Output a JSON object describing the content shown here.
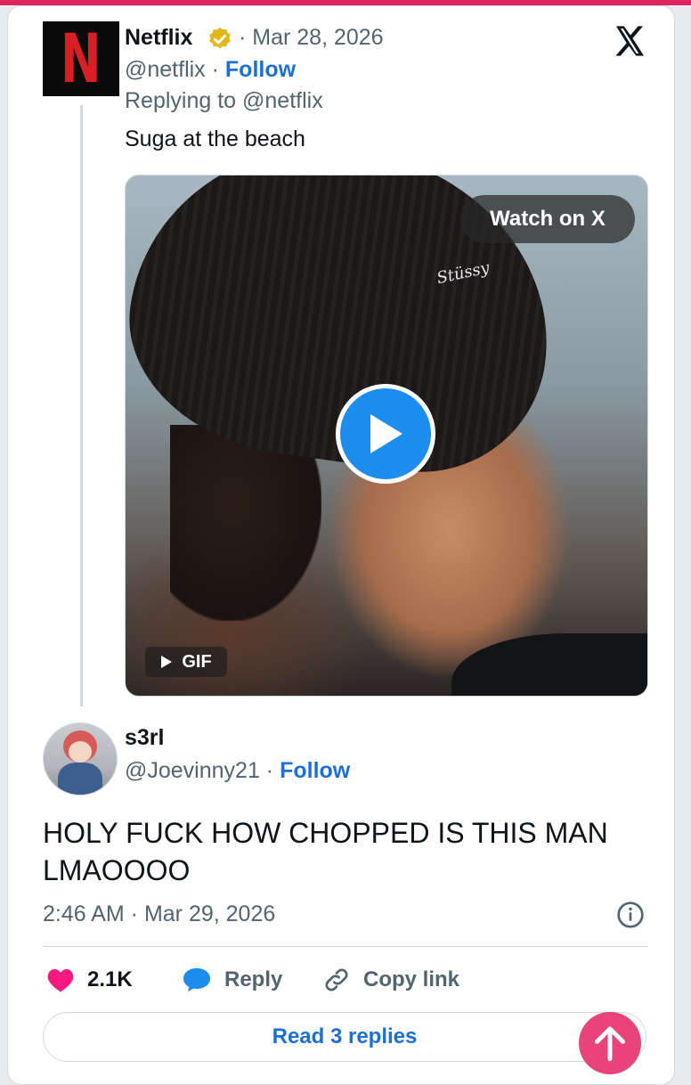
{
  "quoted_tweet": {
    "author_name": "Netflix",
    "date": "· Mar 28, 2026",
    "handle": "@netflix",
    "separator": " · ",
    "follow_label": "Follow",
    "replying_to": "Replying to @netflix",
    "text": "Suga at the beach",
    "media": {
      "watch_label": "Watch on X",
      "gif_label": "GIF",
      "beanie_text": "Stüssy"
    }
  },
  "reply_tweet": {
    "author_name": "s3rl",
    "handle": "@Joevinny21",
    "separator": " · ",
    "follow_label": "Follow",
    "text": "HOLY FUCK HOW CHOPPED IS THIS MAN LMAOOOO",
    "timestamp": "2:46 AM · Mar 29, 2026"
  },
  "actions": {
    "likes": "2.1K",
    "reply_label": "Reply",
    "copy_link_label": "Copy link"
  },
  "read_replies_label": "Read 3 replies",
  "icons": [
    "netflix-logo",
    "verified-badge-icon",
    "x-logo-icon",
    "play-icon",
    "gif-play-icon",
    "info-icon",
    "heart-icon",
    "reply-bubble-icon",
    "link-icon",
    "arrow-up-icon"
  ],
  "colors": {
    "accent": "#1d6fd8",
    "like": "#f91880",
    "top_bar": "#e0245e",
    "scroll_button": "#e8437a"
  }
}
